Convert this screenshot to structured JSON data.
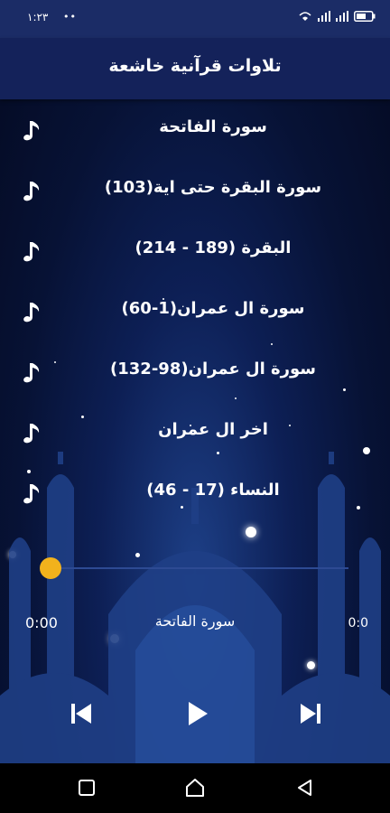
{
  "status_bar": {
    "time": "١:٢٣",
    "dots": "••"
  },
  "app_bar": {
    "title": "تلاوات قرآنية خاشعة"
  },
  "tracks": [
    {
      "label": "سورة الفاتحة",
      "icon": "music-note-icon"
    },
    {
      "label": "سورة البقرة حتى اية(103)",
      "icon": "music-note-icon"
    },
    {
      "label": "البقرة (189 - 214)",
      "icon": "music-note-icon"
    },
    {
      "label": "سورة ال عمران(1-60)",
      "icon": "music-note-icon"
    },
    {
      "label": "سورة ال عمران(98-132)",
      "icon": "music-note-icon"
    },
    {
      "label": "اخر ال عمران",
      "icon": "music-note-icon"
    },
    {
      "label": "النساء (17 - 46)",
      "icon": "music-note-icon"
    }
  ],
  "player": {
    "current_time": "0:00",
    "duration": "0:0",
    "now_playing": "سورة الفاتحة",
    "progress": 0,
    "controls": [
      "skip-previous-icon",
      "play-icon",
      "skip-next-icon"
    ]
  },
  "nav_bar": {
    "buttons": [
      "recents-icon",
      "home-icon",
      "back-icon"
    ]
  },
  "colors": {
    "accent": "#f2b21c",
    "app_bar": "#14225a",
    "status_bar": "#1b2c66",
    "background": "#0b1a4a"
  }
}
